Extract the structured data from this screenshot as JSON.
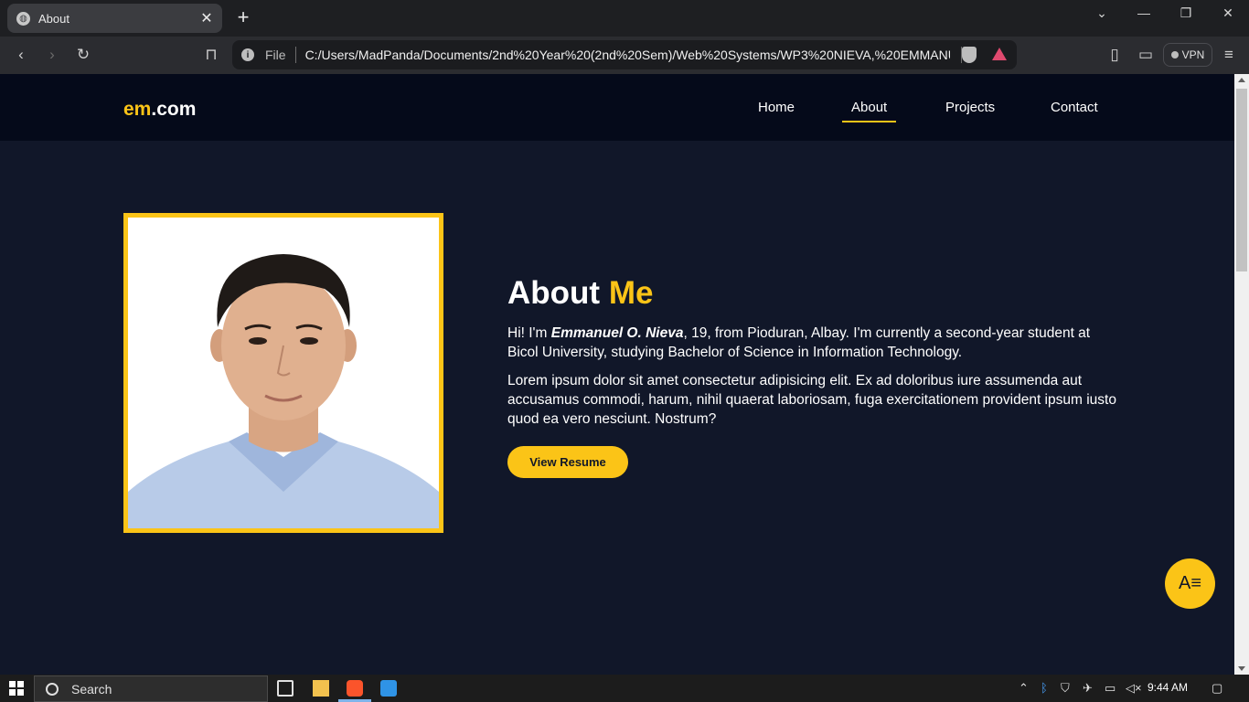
{
  "browser": {
    "tab_title": "About",
    "new_tab": "+",
    "url_scheme": "File",
    "url_path": "C:/Users/MadPanda/Documents/2nd%20Year%20(2nd%20Sem)/Web%20Systems/WP3%20NIEVA,%20EMMANU...",
    "vpn_label": "VPN",
    "controls": {
      "minimize": "—",
      "restore": "❐",
      "close": "✕",
      "dropdown": "⌄"
    }
  },
  "site": {
    "logo_main": "em",
    "logo_accent": ".com",
    "nav": [
      {
        "label": "Home"
      },
      {
        "label": "About"
      },
      {
        "label": "Projects"
      },
      {
        "label": "Contact"
      }
    ],
    "active_nav": "About",
    "heading_main": "About",
    "heading_accent": "Me",
    "intro_prefix": "Hi! I'm ",
    "intro_name": "Emmanuel O. Nieva",
    "intro_suffix": ", 19, from Pioduran, Albay. I'm currently a second-year student at Bicol University, studying Bachelor of Science in Information Technology.",
    "lorem": "Lorem ipsum dolor sit amet consectetur adipisicing elit. Ex ad doloribus iure assumenda aut accusamus commodi, harum, nihil quaerat laboriosam, fuga exercitationem provident ipsum iusto quod ea vero nesciunt. Nostrum?",
    "resume_button": "View Resume",
    "fab_icon": "text-format-icon",
    "accent_color": "#fbc417"
  },
  "taskbar": {
    "search_placeholder": "Search",
    "clock": "9:44 AM"
  }
}
